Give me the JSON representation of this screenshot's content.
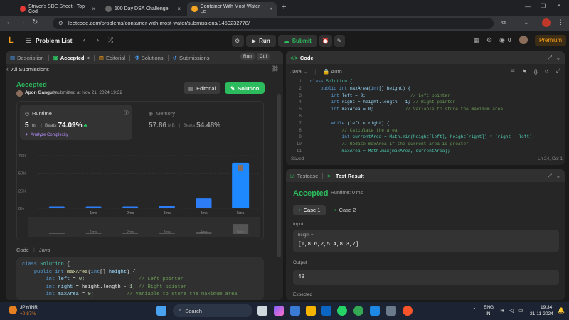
{
  "browser": {
    "tabs": [
      {
        "title": "Striver's SDE Sheet - Top Codi",
        "color": "#e53935"
      },
      {
        "title": "100 Day DSA Challenge",
        "color": "#555"
      },
      {
        "title": "Container With Most Water - Le",
        "color": "#f5a623"
      }
    ],
    "url": "leetcode.com/problems/container-with-most-water/submissions/1459232778/"
  },
  "topbar": {
    "problem_list": "Problem List",
    "run": "Run",
    "submit": "Submit",
    "coins": "0",
    "premium": "Premium"
  },
  "left_tabs": {
    "description": "Description",
    "accepted": "Accepted",
    "editorial": "Editorial",
    "solutions": "Solutions",
    "submissions": "Submissions",
    "run_label": "Run",
    "ctrl": "Ctrl"
  },
  "submission": {
    "back": "All Submissions",
    "status": "Accepted",
    "user": "Apon Ganguly",
    "submitted": "submitted at Nov 21, 2024 19:32",
    "editorial_btn": "Editorial",
    "solution_btn": "Solution",
    "runtime_label": "Runtime",
    "runtime_value": "5",
    "runtime_unit": "ms",
    "beats_label": "Beats",
    "runtime_beats": "74.09%",
    "analyze": "Analyze Complexity",
    "memory_label": "Memory",
    "memory_value": "57.86",
    "memory_unit": "MB",
    "memory_beats": "54.48%"
  },
  "chart_data": {
    "type": "bar",
    "categories": [
      "",
      "1ms",
      "2ms",
      "3ms",
      "4ms",
      "5ms"
    ],
    "values": [
      1.5,
      1.5,
      1.5,
      3.5,
      14,
      65
    ],
    "y_ticks": [
      "75%",
      "50%",
      "25%",
      "0%"
    ],
    "ylim": [
      0,
      75
    ],
    "highlight_index": 5,
    "colors": {
      "normal": "#2d7df6",
      "highlight": "#1e88ff"
    }
  },
  "code_section": {
    "label": "Code",
    "lang": "Java"
  },
  "left_code": [
    "class Solution {",
    "    public int maxArea(int[] height) {",
    "        int left = 0;                  // Left pointer",
    "        int right = height.length - 1; // Right pointer",
    "        int maxArea = 0;           // Variable to store the maximum area"
  ],
  "editor": {
    "title": "Code",
    "lang": "Java",
    "mode": "Auto",
    "saved": "Saved",
    "position": "Ln 24, Col 1",
    "lines": [
      "class Solution {",
      "    public int maxArea(int[] height) {",
      "        int left = 0;                 // Left pointer",
      "        int right = height.length - 1; // Right pointer",
      "        int maxArea = 0;            // Variable to store the maximum area",
      "",
      "        while (left < right) {",
      "            // Calculate the area",
      "            int currentArea = Math.min(height[left], height[right]) * (right - left);",
      "            // Update maxArea if the current area is greater",
      "            maxArea = Math.max(maxArea, currentArea);"
    ]
  },
  "testpanel": {
    "testcase_tab": "Testcase",
    "result_tab": "Test Result",
    "status": "Accepted",
    "runtime": "Runtime: 0 ms",
    "case1": "Case 1",
    "case2": "Case 2",
    "input_label": "Input",
    "param": "height =",
    "input_value": "[1,8,6,2,5,4,8,3,7]",
    "output_label": "Output",
    "output_value": "49",
    "expected_label": "Expected"
  },
  "taskbar": {
    "ticker": "JPY/INR",
    "change": "+0.87%",
    "search": "Search",
    "lang1": "ENG",
    "lang2": "IN",
    "time": "19:34",
    "date": "21-11-2024"
  }
}
